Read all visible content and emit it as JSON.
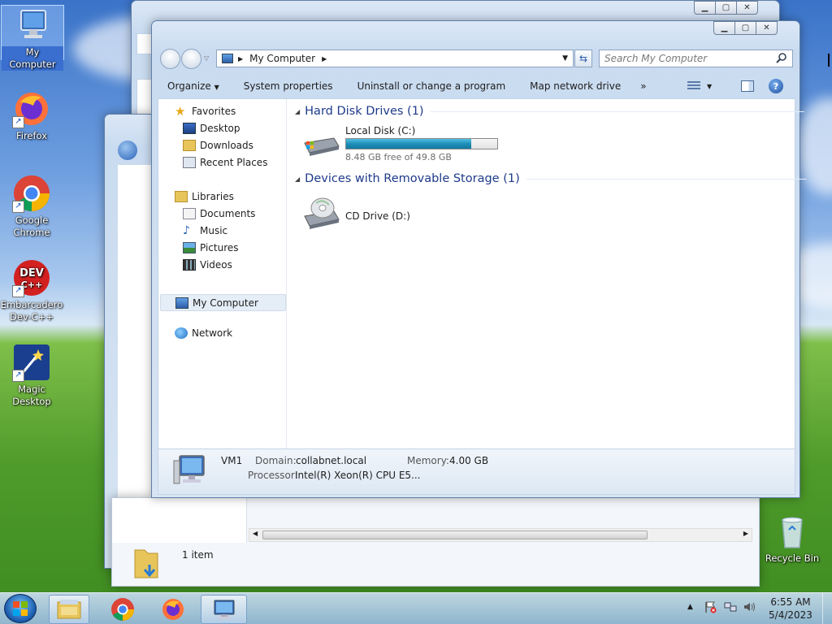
{
  "desktop": {
    "icons": [
      {
        "label": "My Computer"
      },
      {
        "label": "Firefox"
      },
      {
        "label": "Google Chrome"
      },
      {
        "label": "Embarcadero Dev-C++"
      },
      {
        "label": "Magic Desktop"
      },
      {
        "label": "Recycle Bin"
      }
    ]
  },
  "window": {
    "address": "My Computer",
    "search_placeholder": "Search My Computer",
    "toolbar": {
      "organize": "Organize",
      "system_properties": "System properties",
      "uninstall": "Uninstall or change a program",
      "map_drive": "Map network drive",
      "more": "»"
    },
    "nav": {
      "favorites": "Favorites",
      "desktop": "Desktop",
      "downloads": "Downloads",
      "recent": "Recent Places",
      "libraries": "Libraries",
      "documents": "Documents",
      "music": "Music",
      "pictures": "Pictures",
      "videos": "Videos",
      "computer": "My Computer",
      "network": "Network"
    },
    "groups": {
      "hdd": "Hard Disk Drives (1)",
      "removable": "Devices with Removable Storage (1)"
    },
    "drives": {
      "c_name": "Local Disk (C:)",
      "c_free": "8.48 GB free of 49.8 GB",
      "c_used_fraction": 0.83,
      "d_name": "CD Drive (D:)"
    },
    "details": {
      "name": "VM1",
      "domain_label": "Domain:",
      "domain": "collabnet.local",
      "memory_label": "Memory:",
      "memory": "4.00 GB",
      "processor_label": "Processor:",
      "processor": "Intel(R) Xeon(R) CPU E5..."
    }
  },
  "back_window": {
    "status": "1 item"
  },
  "taskbar": {
    "time": "6:55 AM",
    "date": "5/4/2023"
  }
}
